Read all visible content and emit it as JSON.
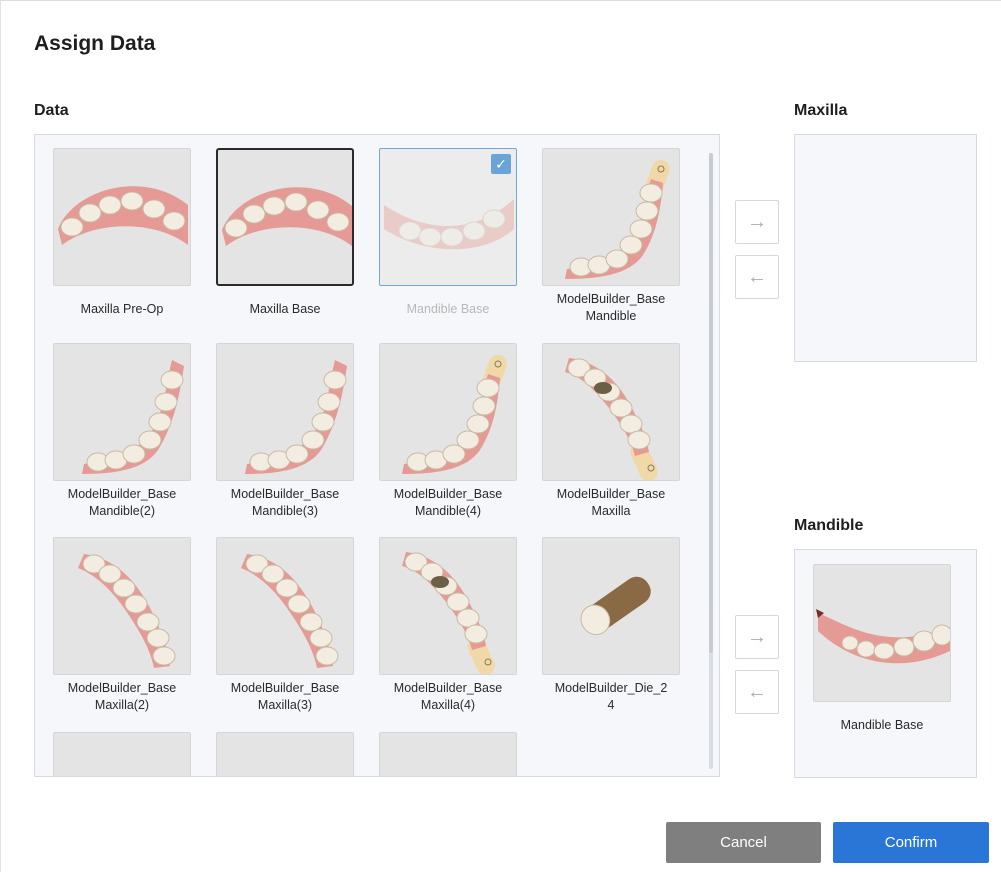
{
  "dialog": {
    "title": "Assign Data"
  },
  "sections": {
    "data": "Data",
    "maxilla": "Maxilla",
    "mandible": "Mandible"
  },
  "tiles": [
    {
      "lines": [
        "Maxilla Pre-Op"
      ],
      "state": "normal",
      "shape": "arch"
    },
    {
      "lines": [
        "Maxilla Base"
      ],
      "state": "selected",
      "shape": "arch"
    },
    {
      "lines": [
        "Mandible Base"
      ],
      "state": "used",
      "shape": "arch-low"
    },
    {
      "lines": [
        "ModelBuilder_Base",
        "Mandible"
      ],
      "state": "normal",
      "shape": "jaw-tag"
    },
    {
      "lines": [
        "ModelBuilder_Base",
        "Mandible(2)"
      ],
      "state": "normal",
      "shape": "jaw"
    },
    {
      "lines": [
        "ModelBuilder_Base",
        "Mandible(3)"
      ],
      "state": "normal",
      "shape": "jaw"
    },
    {
      "lines": [
        "ModelBuilder_Base",
        "Mandible(4)"
      ],
      "state": "normal",
      "shape": "jaw-tag"
    },
    {
      "lines": [
        "ModelBuilder_Base",
        "Maxilla"
      ],
      "state": "normal",
      "shape": "diag-tag"
    },
    {
      "lines": [
        "ModelBuilder_Base",
        "Maxilla(2)"
      ],
      "state": "normal",
      "shape": "diag"
    },
    {
      "lines": [
        "ModelBuilder_Base",
        "Maxilla(3)"
      ],
      "state": "normal",
      "shape": "diag"
    },
    {
      "lines": [
        "ModelBuilder_Base",
        "Maxilla(4)"
      ],
      "state": "normal",
      "shape": "diag-tag"
    },
    {
      "lines": [
        "ModelBuilder_Die_2",
        "4"
      ],
      "state": "normal",
      "shape": "die"
    },
    {
      "lines": [],
      "state": "normal",
      "shape": "partial"
    },
    {
      "lines": [],
      "state": "normal",
      "shape": "partial"
    },
    {
      "lines": [],
      "state": "normal",
      "shape": "partial"
    }
  ],
  "arrows": {
    "right": "→",
    "left": "←"
  },
  "mandible_assigned": {
    "label": "Mandible Base"
  },
  "buttons": {
    "cancel": "Cancel",
    "confirm": "Confirm"
  },
  "icons": {
    "check": "✓"
  },
  "colors": {
    "accent": "#2a76d6",
    "cancel": "#7f7f7f",
    "check": "#6aa3d8"
  }
}
